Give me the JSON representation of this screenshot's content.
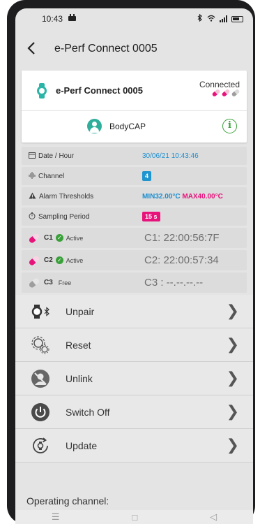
{
  "status_bar": {
    "time": "10:43",
    "app_icon": "notification-app-icon",
    "bluetooth": "bluetooth-icon",
    "wifi": "wifi-icon"
  },
  "header": {
    "back_icon": "back-arrow-icon",
    "title": "e-Perf Connect 0005"
  },
  "device_card": {
    "device_icon": "watch-icon",
    "device_name": "e-Perf Connect 0005",
    "status": "Connected",
    "sensor_pill_colors": [
      "#e8127b",
      "#e8127b",
      "#9e9e9e"
    ],
    "user_icon": "user-avatar-icon",
    "user_name": "BodyCAP",
    "info_icon_label": "i"
  },
  "info_rows": {
    "date": {
      "label": "Date / Hour",
      "value": "30/06/21 10:43:46"
    },
    "channel": {
      "label": "Channel",
      "value": "4"
    },
    "alarm": {
      "label": "Alarm Thresholds",
      "min": "MIN32.00°C",
      "max": "MAX40.00°C"
    },
    "sampling": {
      "label": "Sampling Period",
      "value": "15 s"
    }
  },
  "chips": [
    {
      "name": "C1",
      "state": "Active",
      "value": "C1: 22:00:56:7F",
      "color": "#e8127b",
      "active": true
    },
    {
      "name": "C2",
      "state": "Active",
      "value": "C2: 22:00:57:34",
      "color": "#e8127b",
      "active": true
    },
    {
      "name": "C3",
      "state": "Free",
      "value": "C3 : --.--.--.--",
      "color": "#9e9e9e",
      "active": false
    }
  ],
  "actions": [
    {
      "label": "Unpair",
      "icon": "unpair-icon"
    },
    {
      "label": "Reset",
      "icon": "reset-gear-icon"
    },
    {
      "label": "Unlink",
      "icon": "unlink-user-icon"
    },
    {
      "label": "Switch Off",
      "icon": "power-icon"
    },
    {
      "label": "Update",
      "icon": "update-icon"
    }
  ],
  "footer": {
    "title": "Operating channel:"
  },
  "colors": {
    "accent": "#2cb5a7",
    "blue": "#1d8fd0",
    "pink": "#e8127b",
    "green": "#3aa13a"
  }
}
